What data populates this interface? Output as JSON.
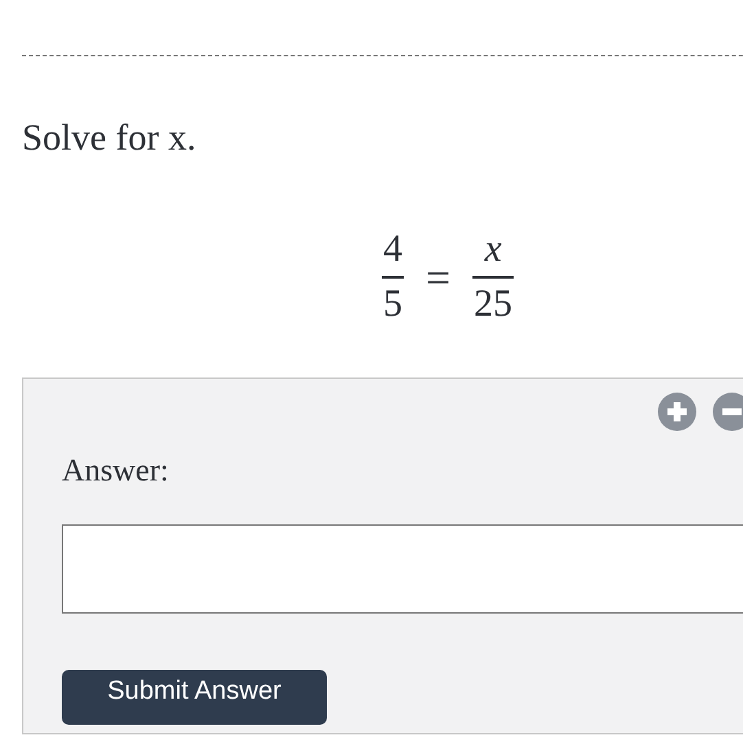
{
  "prompt": "Solve for x.",
  "equation": {
    "left": {
      "numerator": "4",
      "denominator": "5"
    },
    "relation": "=",
    "right": {
      "numerator": "x",
      "denominator": "25"
    }
  },
  "answer_panel": {
    "label": "Answer:",
    "submit_button": "Submit Answer"
  }
}
